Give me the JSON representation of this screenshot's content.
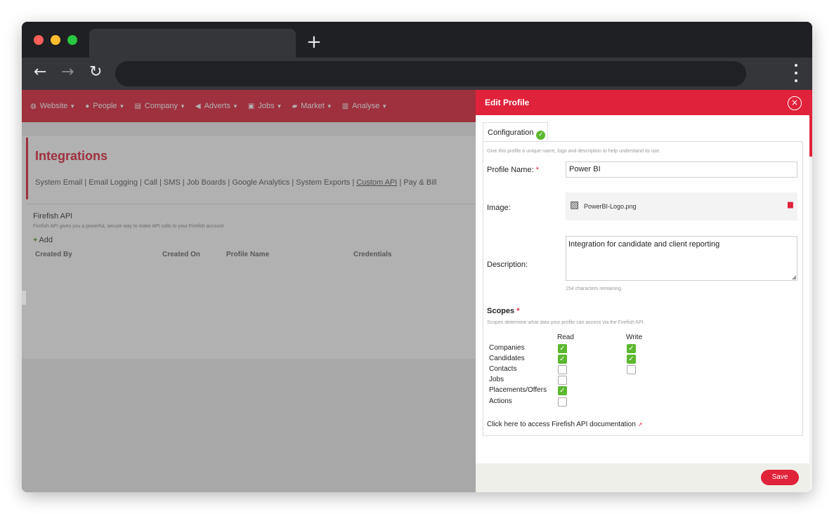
{
  "nav": {
    "items": [
      {
        "label": "Website",
        "icon": "globe-icon"
      },
      {
        "label": "People",
        "icon": "person-icon"
      },
      {
        "label": "Company",
        "icon": "building-icon"
      },
      {
        "label": "Adverts",
        "icon": "megaphone-icon"
      },
      {
        "label": "Jobs",
        "icon": "briefcase-icon"
      },
      {
        "label": "Market",
        "icon": "truck-icon"
      },
      {
        "label": "Analyse",
        "icon": "bar-chart-icon"
      }
    ]
  },
  "integrations": {
    "title": "Integrations",
    "links": [
      "System Email",
      "Email Logging",
      "Call",
      "SMS",
      "Job Boards",
      "Google Analytics",
      "System Exports",
      "Custom API",
      "Pay & Bill"
    ],
    "active_link": "Custom API"
  },
  "api": {
    "title": "Firefish API",
    "description": "Firefish API gives you a powerful, secure way to make API calls to your Firefish account.",
    "add_label": "Add",
    "columns": [
      "Created By",
      "Created On",
      "Profile Name",
      "Credentials"
    ]
  },
  "panel": {
    "title": "Edit Profile",
    "tab_label": "Configuration",
    "intro": "Give this profile a unique name, logo and description to help understand its use.",
    "profile_name_label": "Profile Name:",
    "profile_name_value": "Power BI",
    "image_label": "Image:",
    "image_file": "PowerBI-Logo.png",
    "description_label": "Description:",
    "description_value": "Integration for candidate and client reporting",
    "chars_remaining": "154 characters remaining.",
    "scopes_title": "Scopes",
    "scopes_help": "Scopes determine what data your profile can access via the Firefish API.",
    "read_label": "Read",
    "write_label": "Write",
    "scopes": [
      {
        "name": "Companies",
        "read": true,
        "write": true
      },
      {
        "name": "Candidates",
        "read": true,
        "write": true
      },
      {
        "name": "Contacts",
        "read": false,
        "write": false
      },
      {
        "name": "Jobs",
        "read": false,
        "write": null
      },
      {
        "name": "Placements/Offers",
        "read": true,
        "write": null
      },
      {
        "name": "Actions",
        "read": false,
        "write": null
      }
    ],
    "doc_link": "Click here to access Firefish API documentation",
    "save_label": "Save"
  },
  "colors": {
    "brand": "#e0223a",
    "check": "#5cb82e"
  }
}
